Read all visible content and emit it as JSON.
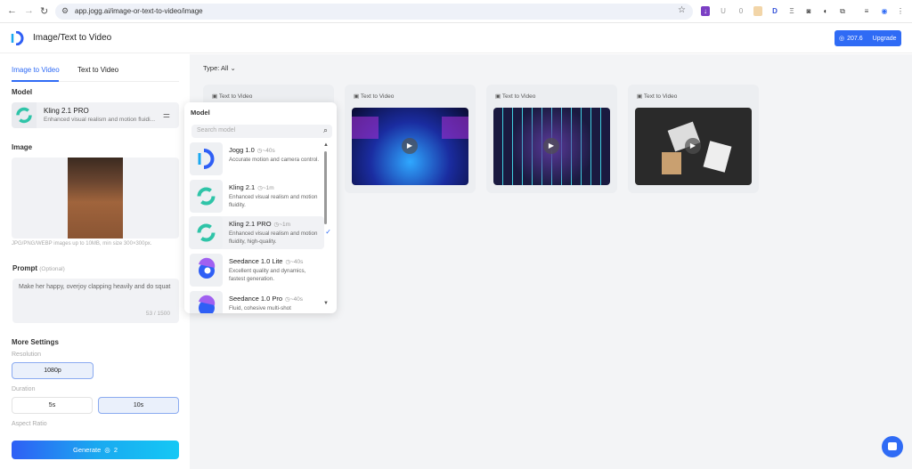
{
  "browser": {
    "url": "app.jogg.ai/image-or-text-to-video/image"
  },
  "header": {
    "title": "Image/Text to Video",
    "credits": "207.6",
    "upgrade": "Upgrade"
  },
  "sidebar": {
    "tabs": [
      {
        "label": "Image to Video",
        "active": true
      },
      {
        "label": "Text to Video",
        "active": false
      }
    ],
    "model_label": "Model",
    "model": {
      "name": "Kling 2.1 PRO",
      "desc": "Enhanced visual realism and motion fluidi..."
    },
    "image_label": "Image",
    "image_hint": "JPG/PNG/WEBP images up to 10MB, min size 300×300px.",
    "prompt_label": "Prompt",
    "prompt_optional": "(Optional)",
    "prompt_value": "Make her happy, overjoy clapping heavily and do squat",
    "prompt_count": "53 / 1500",
    "more_settings": "More Settings",
    "resolution_label": "Resolution",
    "resolution": "1080p",
    "duration_label": "Duration",
    "durations": [
      {
        "label": "5s",
        "selected": false
      },
      {
        "label": "10s",
        "selected": true
      }
    ],
    "aspect_label": "Aspect Ratio",
    "generate": "Generate",
    "generate_cost": "2"
  },
  "main": {
    "type_filter": "Type: All",
    "cards": [
      {
        "label": "Text to Video"
      },
      {
        "label": "Text to Video"
      },
      {
        "label": "Text to Video"
      },
      {
        "label": "Text to Video"
      }
    ]
  },
  "dropdown": {
    "title": "Model",
    "search_placeholder": "Search model",
    "items": [
      {
        "name": "Jogg 1.0",
        "time": "~40s",
        "desc": "Accurate motion and camera control."
      },
      {
        "name": "Kling 2.1",
        "time": "~1m",
        "desc": "Enhanced visual realism and motion fluidity."
      },
      {
        "name": "Kling 2.1 PRO",
        "time": "~1m",
        "desc": "Enhanced visual realism and motion fluidity, high-quality.",
        "selected": true
      },
      {
        "name": "Seedance 1.0 Lite",
        "time": "~40s",
        "desc": "Excellent quality and dynamics, fastest generation."
      },
      {
        "name": "Seedance 1.0 Pro",
        "time": "~40s",
        "desc": "Fluid, cohesive multi-shot"
      }
    ]
  },
  "colors": {
    "accent": "#2f6bf5"
  }
}
